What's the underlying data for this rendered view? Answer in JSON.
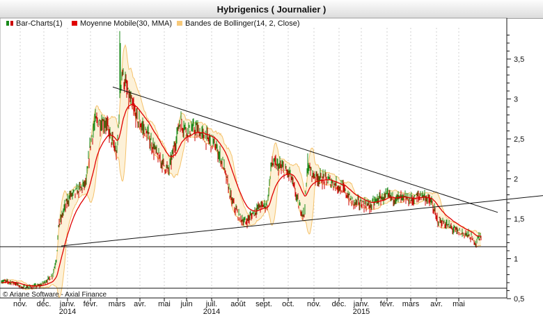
{
  "chart_data": {
    "type": "line",
    "title": "Hybrigenics  ( Journalier )",
    "legend": [
      {
        "label": "Bar-Charts(1)",
        "color": "#1a8a1a",
        "color2": "#cc0000"
      },
      {
        "label": "Moyenne Mobile(30, MMA)",
        "color": "#e00000"
      },
      {
        "label": "Bandes de Bollinger(14, 2, Close)",
        "color": "#f7c97a"
      }
    ],
    "legend_placement": "top-left",
    "copyright": "© Ariane Software - Axial Finance",
    "y_ticks": [
      "3,5",
      "3",
      "2,5",
      "2",
      "1,5",
      "1",
      "0,5"
    ],
    "ylim": [
      0.5,
      3.9
    ],
    "x_months": [
      "nov.",
      "déc.",
      "janv.",
      "févr.",
      "mars",
      "avr.",
      "mai",
      "juin",
      "juil.",
      "août",
      "sept.",
      "oct.",
      "nov.",
      "déc.",
      "janv.",
      "févr.",
      "mars",
      "avr.",
      "mai"
    ],
    "x_years": [
      "2014",
      "2014",
      "2015"
    ],
    "grid": true,
    "grid_style": "dashed-vertical",
    "price_anchors": [
      [
        0,
        0.72
      ],
      [
        18,
        0.7
      ],
      [
        30,
        0.64
      ],
      [
        55,
        0.66
      ],
      [
        73,
        0.78
      ],
      [
        79,
        1.0
      ],
      [
        82,
        1.38
      ],
      [
        90,
        1.62
      ],
      [
        98,
        1.78
      ],
      [
        110,
        1.85
      ],
      [
        122,
        1.95
      ],
      [
        128,
        2.45
      ],
      [
        135,
        2.72
      ],
      [
        150,
        2.7
      ],
      [
        160,
        2.45
      ],
      [
        166,
        2.3
      ],
      [
        170,
        3.0
      ],
      [
        173,
        3.35
      ],
      [
        182,
        3.05
      ],
      [
        195,
        2.75
      ],
      [
        210,
        2.55
      ],
      [
        225,
        2.28
      ],
      [
        240,
        2.1
      ],
      [
        250,
        2.45
      ],
      [
        256,
        2.72
      ],
      [
        268,
        2.6
      ],
      [
        280,
        2.62
      ],
      [
        292,
        2.52
      ],
      [
        305,
        2.45
      ],
      [
        318,
        2.2
      ],
      [
        330,
        1.75
      ],
      [
        340,
        1.55
      ],
      [
        350,
        1.45
      ],
      [
        360,
        1.55
      ],
      [
        370,
        1.65
      ],
      [
        382,
        1.68
      ],
      [
        388,
        2.2
      ],
      [
        400,
        2.15
      ],
      [
        415,
        2.05
      ],
      [
        428,
        1.65
      ],
      [
        435,
        1.55
      ],
      [
        440,
        2.15
      ],
      [
        448,
        2.05
      ],
      [
        460,
        2.0
      ],
      [
        470,
        1.98
      ],
      [
        490,
        1.88
      ],
      [
        505,
        1.7
      ],
      [
        515,
        1.7
      ],
      [
        530,
        1.66
      ],
      [
        542,
        1.75
      ],
      [
        555,
        1.78
      ],
      [
        570,
        1.76
      ],
      [
        590,
        1.74
      ],
      [
        605,
        1.8
      ],
      [
        618,
        1.7
      ],
      [
        625,
        1.5
      ],
      [
        640,
        1.42
      ],
      [
        655,
        1.34
      ],
      [
        670,
        1.3
      ],
      [
        682,
        1.2
      ],
      [
        686,
        1.28
      ]
    ],
    "trendline_upper": {
      "x": [
        162,
        715
      ],
      "y": [
        3.15,
        1.58
      ]
    },
    "trendline_lower": {
      "x": [
        88,
        780
      ],
      "y": [
        1.16,
        1.79
      ]
    },
    "horizontal_levels": [
      1.15,
      0.63
    ],
    "ma_period": 30,
    "bollinger": {
      "period": 14,
      "k": 2
    }
  }
}
